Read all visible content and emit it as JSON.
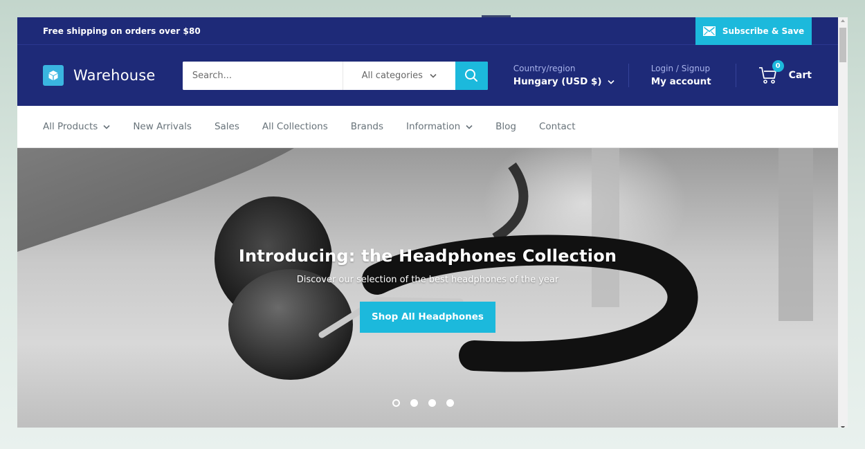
{
  "announcement": {
    "text": "Free shipping on orders over $80",
    "subscribe_label": "Subscribe & Save",
    "subscribe_icon": "envelope-icon"
  },
  "header": {
    "logo_text": "Warehouse",
    "logo_icon": "cube-icon",
    "search": {
      "placeholder": "Search...",
      "value": "",
      "category_label": "All categories",
      "button_icon": "search-icon"
    },
    "region": {
      "label": "Country/region",
      "value": "Hungary (USD $)"
    },
    "account": {
      "label": "Login / Signup",
      "value": "My account"
    },
    "cart": {
      "label": "Cart",
      "count": "0",
      "icon": "cart-icon"
    }
  },
  "nav": {
    "items": [
      {
        "label": "All Products",
        "has_dropdown": true
      },
      {
        "label": "New Arrivals",
        "has_dropdown": false
      },
      {
        "label": "Sales",
        "has_dropdown": false
      },
      {
        "label": "All Collections",
        "has_dropdown": false
      },
      {
        "label": "Brands",
        "has_dropdown": false
      },
      {
        "label": "Information",
        "has_dropdown": true
      },
      {
        "label": "Blog",
        "has_dropdown": false
      },
      {
        "label": "Contact",
        "has_dropdown": false
      }
    ]
  },
  "hero": {
    "title": "Introducing: the Headphones Collection",
    "subtitle": "Discover our selection of the best headphones of the year",
    "button_label": "Shop All Headphones",
    "slide_count": 4,
    "active_slide": 1
  },
  "colors": {
    "brand_navy": "#1e2a78",
    "accent_cyan": "#1cb9dc",
    "nav_text": "#677279"
  }
}
